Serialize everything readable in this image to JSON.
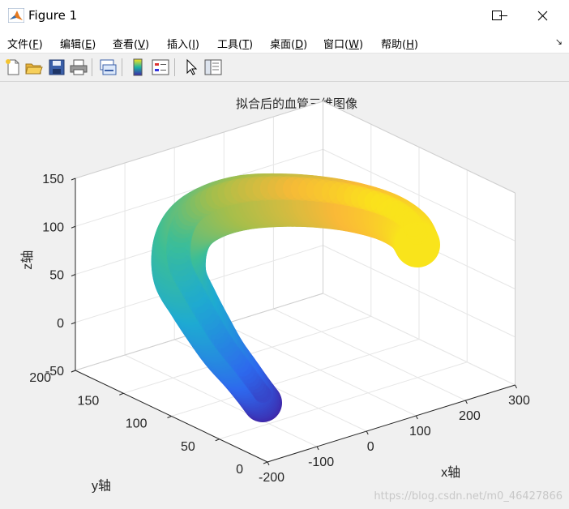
{
  "window": {
    "title": "Figure 1"
  },
  "menu": [
    {
      "text": "文件(",
      "key": "F",
      "close": ")"
    },
    {
      "text": "编辑(",
      "key": "E",
      "close": ")"
    },
    {
      "text": "查看(",
      "key": "V",
      "close": ")"
    },
    {
      "text": "插入(",
      "key": "I",
      "close": ")"
    },
    {
      "text": "工具(",
      "key": "T",
      "close": ")"
    },
    {
      "text": "桌面(",
      "key": "D",
      "close": ")"
    },
    {
      "text": "窗口(",
      "key": "W",
      "close": ")"
    },
    {
      "text": "帮助(",
      "key": "H",
      "close": ")"
    }
  ],
  "toolbar": [
    "new-figure-icon",
    "open-file-icon",
    "save-icon",
    "print-icon",
    "link-plot-icon",
    "insert-colorbar-icon",
    "insert-legend-icon",
    "pointer-icon",
    "property-inspector-icon"
  ],
  "chart_data": {
    "type": "3d-surface",
    "title": "拟合后的血管三维图像",
    "xlabel": "x轴",
    "ylabel": "y轴",
    "zlabel": "z轴",
    "xticks": [
      "-200",
      "-100",
      "0",
      "100",
      "200",
      "300"
    ],
    "yticks": [
      "0",
      "50",
      "100",
      "150",
      "200"
    ],
    "zticks": [
      "-50",
      "0",
      "50",
      "100",
      "150"
    ],
    "xlim": [
      -200,
      300
    ],
    "ylim": [
      0,
      200
    ],
    "zlim": [
      -50,
      150
    ],
    "colormap": "parula",
    "grid": true
  },
  "watermark": "https://blog.csdn.net/m0_46427866"
}
